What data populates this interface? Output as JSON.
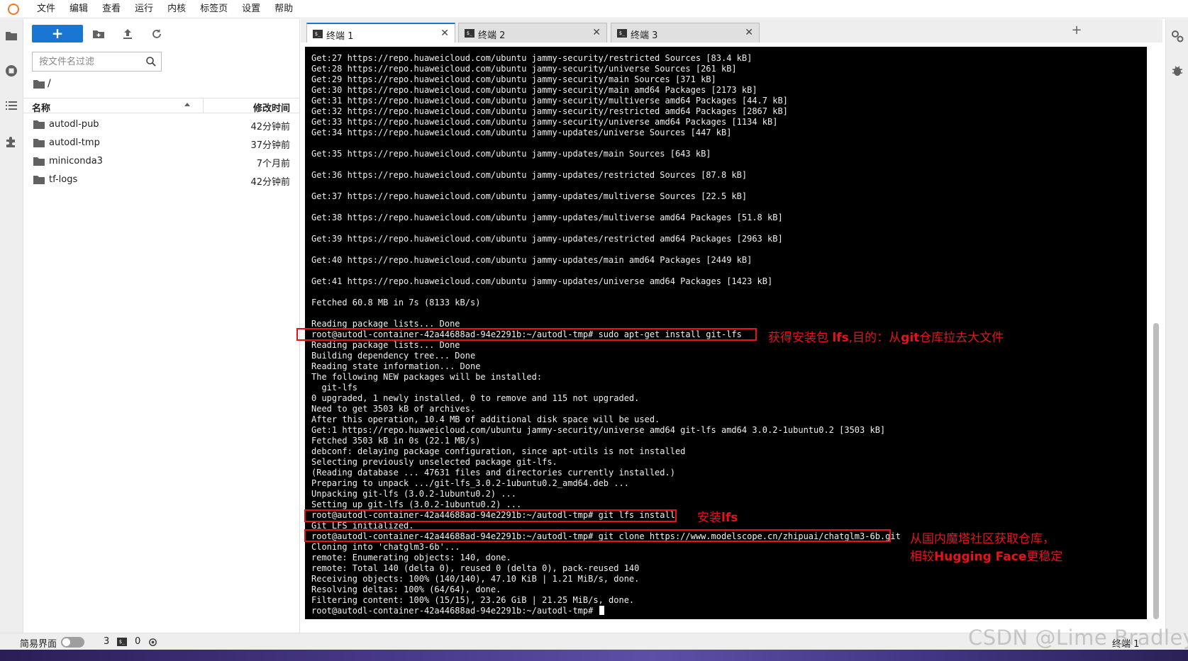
{
  "menubar": {
    "items": [
      "文件",
      "编辑",
      "查看",
      "运行",
      "内核",
      "标签页",
      "设置",
      "帮助"
    ]
  },
  "filebrowser": {
    "new_button_label": "+",
    "filter_placeholder": "按文件名过滤",
    "breadcrumb": "/",
    "column_name": "名称",
    "column_modified": "修改时间",
    "files": [
      {
        "name": "autodl-pub",
        "modified": "42分钟前"
      },
      {
        "name": "autodl-tmp",
        "modified": "37分钟前"
      },
      {
        "name": "miniconda3",
        "modified": "7个月前"
      },
      {
        "name": "tf-logs",
        "modified": "42分钟前"
      }
    ]
  },
  "tabs": [
    {
      "label": "终端 1",
      "active": true
    },
    {
      "label": "终端 2",
      "active": false
    },
    {
      "label": "终端 3",
      "active": false
    }
  ],
  "terminal": {
    "lines": [
      "Get:27 https://repo.huaweicloud.com/ubuntu jammy-security/restricted Sources [83.4 kB]",
      "Get:28 https://repo.huaweicloud.com/ubuntu jammy-security/universe Sources [261 kB]",
      "Get:29 https://repo.huaweicloud.com/ubuntu jammy-security/main Sources [371 kB]",
      "Get:30 https://repo.huaweicloud.com/ubuntu jammy-security/main amd64 Packages [2173 kB]",
      "Get:31 https://repo.huaweicloud.com/ubuntu jammy-security/multiverse amd64 Packages [44.7 kB]",
      "Get:32 https://repo.huaweicloud.com/ubuntu jammy-security/restricted amd64 Packages [2867 kB]",
      "Get:33 https://repo.huaweicloud.com/ubuntu jammy-security/universe amd64 Packages [1134 kB]",
      "Get:34 https://repo.huaweicloud.com/ubuntu jammy-updates/universe Sources [447 kB]",
      "",
      "Get:35 https://repo.huaweicloud.com/ubuntu jammy-updates/main Sources [643 kB]",
      "",
      "Get:36 https://repo.huaweicloud.com/ubuntu jammy-updates/restricted Sources [87.8 kB]",
      "",
      "Get:37 https://repo.huaweicloud.com/ubuntu jammy-updates/multiverse Sources [22.5 kB]",
      "",
      "Get:38 https://repo.huaweicloud.com/ubuntu jammy-updates/multiverse amd64 Packages [51.8 kB]",
      "",
      "Get:39 https://repo.huaweicloud.com/ubuntu jammy-updates/restricted amd64 Packages [2963 kB]",
      "",
      "Get:40 https://repo.huaweicloud.com/ubuntu jammy-updates/main amd64 Packages [2449 kB]",
      "",
      "Get:41 https://repo.huaweicloud.com/ubuntu jammy-updates/universe amd64 Packages [1423 kB]",
      "",
      "Fetched 60.8 MB in 7s (8133 kB/s)",
      "",
      "Reading package lists... Done",
      "root@autodl-container-42a44688ad-94e2291b:~/autodl-tmp# sudo apt-get install git-lfs",
      "Reading package lists... Done",
      "Building dependency tree... Done",
      "Reading state information... Done",
      "The following NEW packages will be installed:",
      "  git-lfs",
      "0 upgraded, 1 newly installed, 0 to remove and 115 not upgraded.",
      "Need to get 3503 kB of archives.",
      "After this operation, 10.4 MB of additional disk space will be used.",
      "Get:1 https://repo.huaweicloud.com/ubuntu jammy-security/universe amd64 git-lfs amd64 3.0.2-1ubuntu0.2 [3503 kB]",
      "Fetched 3503 kB in 0s (22.1 MB/s)",
      "debconf: delaying package configuration, since apt-utils is not installed",
      "Selecting previously unselected package git-lfs.",
      "(Reading database ... 47631 files and directories currently installed.)",
      "Preparing to unpack .../git-lfs_3.0.2-1ubuntu0.2_amd64.deb ...",
      "Unpacking git-lfs (3.0.2-1ubuntu0.2) ...",
      "Setting up git-lfs (3.0.2-1ubuntu0.2) ...",
      "root@autodl-container-42a44688ad-94e2291b:~/autodl-tmp# git lfs install",
      "Git LFS initialized.",
      "root@autodl-container-42a44688ad-94e2291b:~/autodl-tmp# git clone https://www.modelscope.cn/zhipuai/chatglm3-6b.git",
      "Cloning into 'chatglm3-6b'...",
      "remote: Enumerating objects: 140, done.",
      "remote: Total 140 (delta 0), reused 0 (delta 0), pack-reused 140",
      "Receiving objects: 100% (140/140), 47.10 KiB | 1.21 MiB/s, done.",
      "Resolving deltas: 100% (64/64), done.",
      "Filtering content: 100% (15/15), 23.26 GiB | 21.25 MiB/s, done.",
      "root@autodl-container-42a44688ad-94e2291b:~/autodl-tmp# "
    ]
  },
  "annotations": {
    "apt_install": {
      "prefix": "获得安装包 ",
      "bold": "lfs",
      "suffix": ",目的：从",
      "bold2": "git",
      "suffix2": "仓库拉去大文件"
    },
    "lfs_install": {
      "prefix": "安装",
      "bold": "lfs"
    },
    "clone_line1": "从国内魔塔社区获取仓库，",
    "clone_line2_prefix": "相较",
    "clone_line2_bold": "Hugging Face",
    "clone_line2_suffix": "更稳定",
    "color": "#e8121b"
  },
  "statusbar": {
    "simple_mode_label": "简易界面",
    "kernel_count": "3",
    "terminal_count": "0",
    "right_label": "终端 1"
  },
  "watermark": "CSDN @Lime Bradley",
  "colors": {
    "accent": "#1976d2",
    "terminal_bg": "#000000",
    "annotation": "#e8121b"
  }
}
